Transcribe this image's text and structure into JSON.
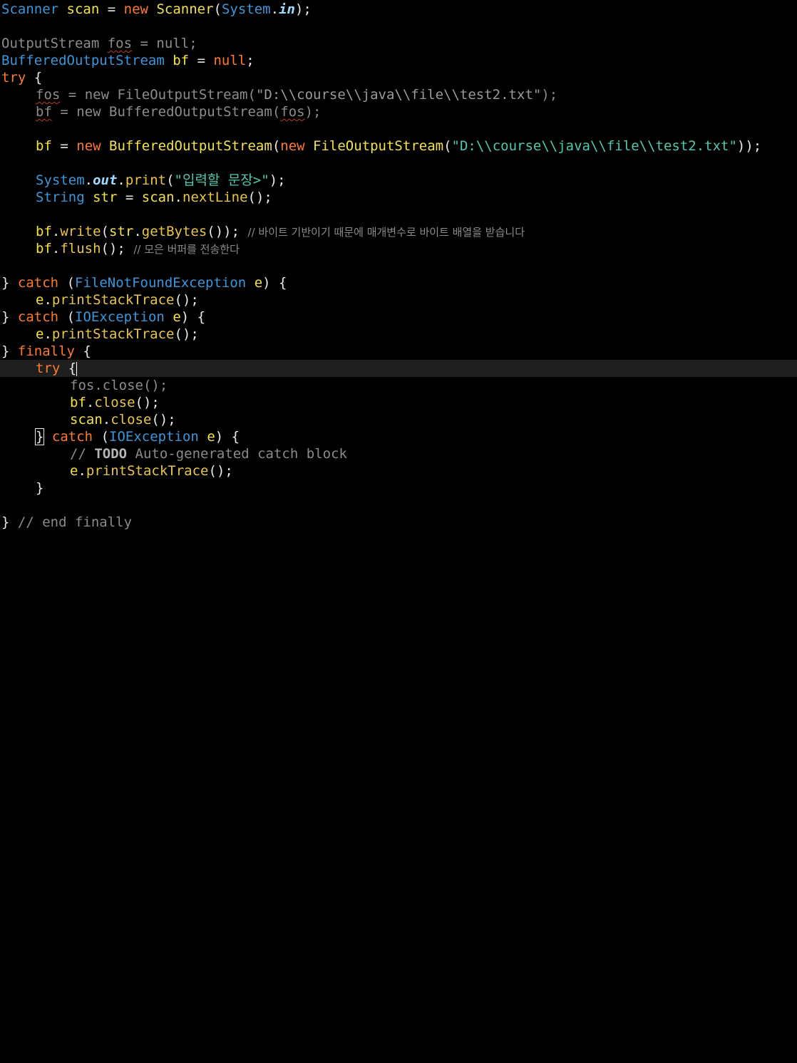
{
  "code": {
    "scanner_type": "Scanner",
    "scanner_var": "scan",
    "kw_new": "new",
    "system": "System",
    "in": "in",
    "output_stream": "OutputStream",
    "fos": "fos",
    "null_kw": "null",
    "buffered_output_stream": "BufferedOutputStream",
    "bf": "bf",
    "try_kw": "try",
    "file_output_stream": "FileOutputStream",
    "path_literal": "\"D:\\\\course\\\\java\\\\file\\\\test2.txt\"",
    "out": "out",
    "print": "print",
    "prompt_literal": "\"입력할 문장>\"",
    "string_type": "String",
    "str": "str",
    "nextLine": "nextLine",
    "write": "write",
    "getBytes": "getBytes",
    "comment_write": "// 바이트 기반이기 때문에 매개변수로 바이트 배열을 받습니다",
    "flush": "flush",
    "comment_flush": "// 모은 버퍼를 전송한다",
    "catch_kw": "catch",
    "fnf_exception": "FileNotFoundException",
    "e": "e",
    "printStackTrace": "printStackTrace",
    "io_exception": "IOException",
    "finally_kw": "finally",
    "close": "close",
    "todo_prefix": "// ",
    "todo": "TODO",
    "todo_rest": " Auto-generated catch block",
    "end_finally_comment": "// end finally"
  }
}
